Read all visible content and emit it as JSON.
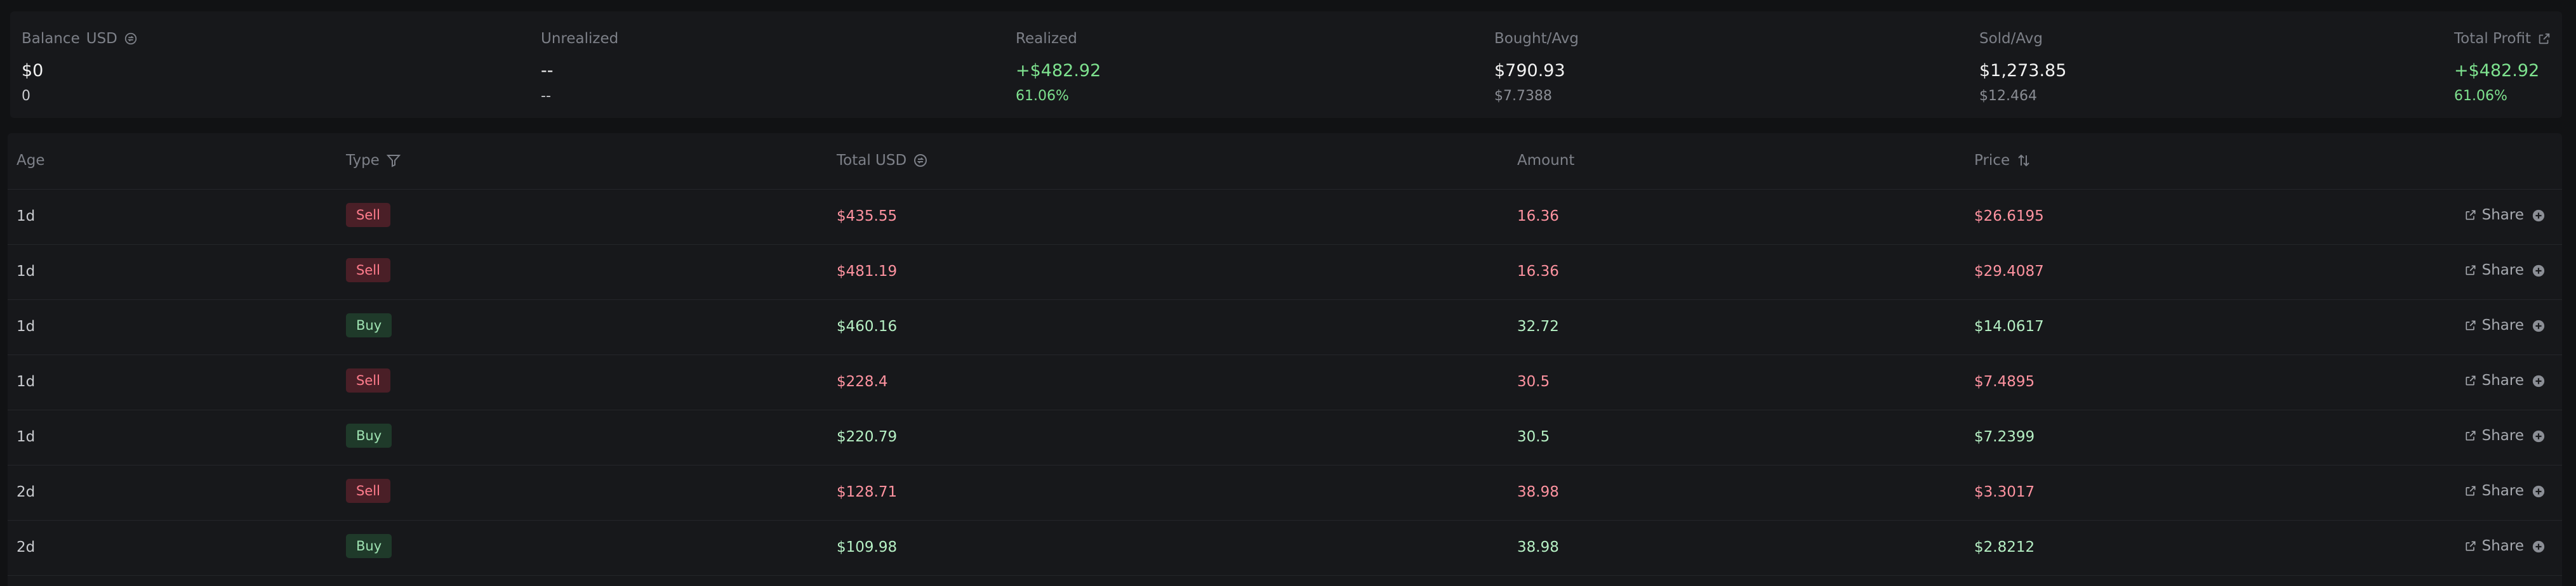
{
  "summary": {
    "balance": {
      "label": "Balance",
      "unit": "USD",
      "value": "$0",
      "sub": "0"
    },
    "unrealized": {
      "label": "Unrealized",
      "value": "--",
      "sub": "--"
    },
    "realized": {
      "label": "Realized",
      "value": "+$482.92",
      "sub": "61.06%"
    },
    "bought": {
      "label": "Bought/Avg",
      "value": "$790.93",
      "sub": "$7.7388"
    },
    "sold": {
      "label": "Sold/Avg",
      "value": "$1,273.85",
      "sub": "$12.464"
    },
    "total_profit": {
      "label": "Total Profit",
      "value": "+$482.92",
      "sub": "61.06%"
    }
  },
  "table": {
    "headers": {
      "age": "Age",
      "type": "Type",
      "total": "Total USD",
      "amount": "Amount",
      "price": "Price"
    },
    "share_label": "Share",
    "rows": [
      {
        "age": "1d",
        "type": "Sell",
        "total": "$435.55",
        "amount": "16.36",
        "price": "$26.6195"
      },
      {
        "age": "1d",
        "type": "Sell",
        "total": "$481.19",
        "amount": "16.36",
        "price": "$29.4087"
      },
      {
        "age": "1d",
        "type": "Buy",
        "total": "$460.16",
        "amount": "32.72",
        "price": "$14.0617"
      },
      {
        "age": "1d",
        "type": "Sell",
        "total": "$228.4",
        "amount": "30.5",
        "price": "$7.4895"
      },
      {
        "age": "1d",
        "type": "Buy",
        "total": "$220.79",
        "amount": "30.5",
        "price": "$7.2399"
      },
      {
        "age": "2d",
        "type": "Sell",
        "total": "$128.71",
        "amount": "38.98",
        "price": "$3.3017"
      },
      {
        "age": "2d",
        "type": "Buy",
        "total": "$109.98",
        "amount": "38.98",
        "price": "$2.8212"
      }
    ]
  },
  "colors": {
    "sell": "#ff93a0",
    "buy": "#b6f0c4",
    "profit": "#7ee28f",
    "background": "#111214"
  }
}
